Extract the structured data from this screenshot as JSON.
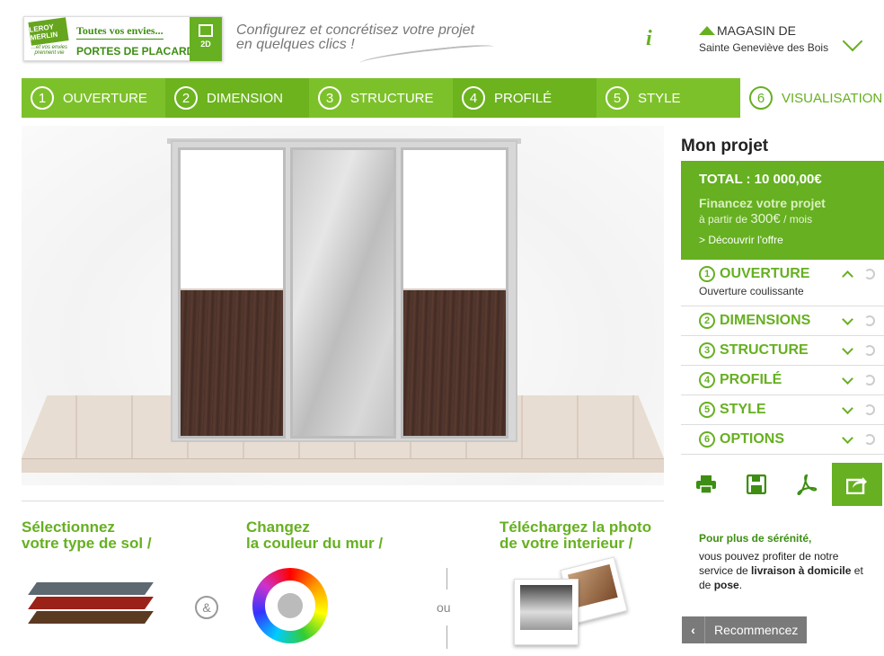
{
  "header": {
    "brand_line1": "Toutes vos envies...",
    "brand_line2": "PORTES DE PLACARD",
    "view_toggle": "2D",
    "tagline_line1": "Configurez et concrétisez votre projet",
    "tagline_line2": "en quelques clics !",
    "info_icon": "i",
    "store_label": "MAGASIN DE",
    "store_name": "Sainte Geneviève des Bois"
  },
  "steps": [
    {
      "num": "1",
      "label": "OUVERTURE"
    },
    {
      "num": "2",
      "label": "DIMENSION"
    },
    {
      "num": "3",
      "label": "STRUCTURE"
    },
    {
      "num": "4",
      "label": "PROFILÉ"
    },
    {
      "num": "5",
      "label": "STYLE"
    },
    {
      "num": "6",
      "label": "VISUALISATION"
    }
  ],
  "options": {
    "sol_title_1": "Sélectionnez",
    "sol_title_2": "votre type de sol /",
    "ampersand": "&",
    "mur_title_1": "Changez",
    "mur_title_2": "la couleur du mur /",
    "ou": "ou",
    "photo_title_1": "Téléchargez la photo",
    "photo_title_2": "de votre interieur /"
  },
  "project": {
    "title": "Mon projet",
    "total": "TOTAL : 10 000,00€",
    "finance_title": "Financez votre projet",
    "finance_prefix": "à partir de",
    "finance_amount": "300€",
    "finance_suffix": "/ mois",
    "discover": "> Découvrir l'offre",
    "sections": [
      {
        "num": "1",
        "label": "OUVERTURE",
        "sub": "Ouverture coulissante"
      },
      {
        "num": "2",
        "label": "DIMENSIONS"
      },
      {
        "num": "3",
        "label": "STRUCTURE"
      },
      {
        "num": "4",
        "label": "PROFILÉ"
      },
      {
        "num": "5",
        "label": "STYLE"
      },
      {
        "num": "6",
        "label": "OPTIONS"
      }
    ],
    "tools": [
      "print-icon",
      "save-icon",
      "pdf-icon",
      "share-icon"
    ],
    "serenite_head": "Pour plus de sérénité,",
    "serenite_text1": "vous pouvez profiter de notre service de",
    "serenite_bold1": "livraison à domicile",
    "serenite_text2": "et de",
    "serenite_bold2": "pose",
    "serenite_end": ".",
    "restart_arrow": "‹",
    "restart": "Recommencez"
  },
  "colors": {
    "accent": "#66b021",
    "accent_dark": "#3d8e13",
    "step_bg": "#7dc12a"
  }
}
